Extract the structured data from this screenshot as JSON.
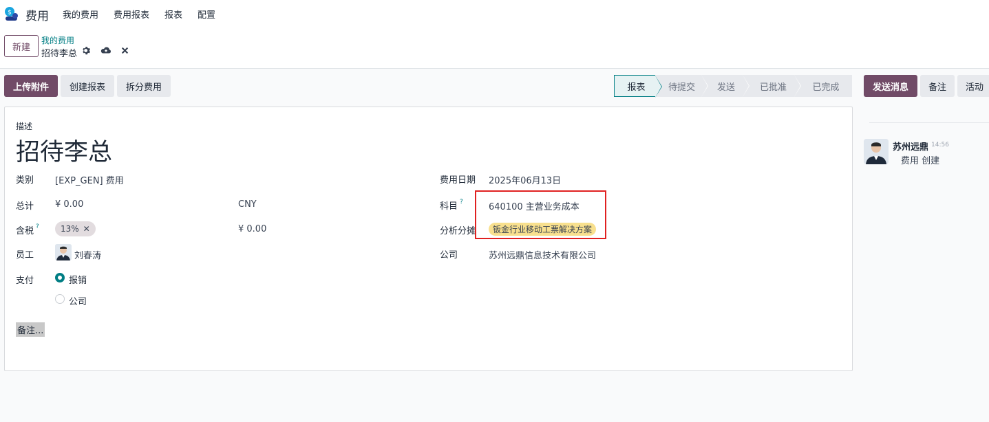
{
  "navbar": {
    "app_name": "费用",
    "menu": [
      "我的费用",
      "费用报表",
      "报表",
      "配置"
    ]
  },
  "control": {
    "new_label": "新建",
    "breadcrumb_parent": "我的费用",
    "breadcrumb_current": "招待李总"
  },
  "actions": {
    "upload": "上传附件",
    "create_report": "创建报表",
    "split": "拆分费用"
  },
  "status_stages": [
    "报表",
    "待提交",
    "发送",
    "已批准",
    "已完成"
  ],
  "status_active": "报表",
  "chatter_buttons": {
    "send_message": "发送消息",
    "note": "备注",
    "activity": "活动"
  },
  "form": {
    "description_label": "描述",
    "title": "招待李总",
    "category_label": "类别",
    "category_value": "[EXP_GEN] 费用",
    "total_label": "总计",
    "total_value": "¥ 0.00",
    "currency": "CNY",
    "tax_label": "含税",
    "tax_tag": "13%",
    "tax_amount": "¥ 0.00",
    "employee_label": "员工",
    "employee_value": "刘春涛",
    "payment_label": "支付",
    "payment_options": [
      "报销",
      "公司"
    ],
    "payment_selected": "报销",
    "date_label": "费用日期",
    "date_value": "2025年06月13日",
    "account_label": "科目",
    "account_value": "640100 主营业务成本",
    "analytic_label": "分析分摊",
    "analytic_tag": "钣金行业移动工票解决方案",
    "company_label": "公司",
    "company_value": "苏州远鼎信息技术有限公司",
    "note_placeholder": "备注..."
  },
  "chatter": {
    "author": "苏州远鼎",
    "time": "14:56",
    "body": "费用 创建"
  },
  "colors": {
    "brand": "#714b67",
    "accent": "#017e84",
    "highlight": "#e02020",
    "tag_yellow": "#f8e08e"
  }
}
